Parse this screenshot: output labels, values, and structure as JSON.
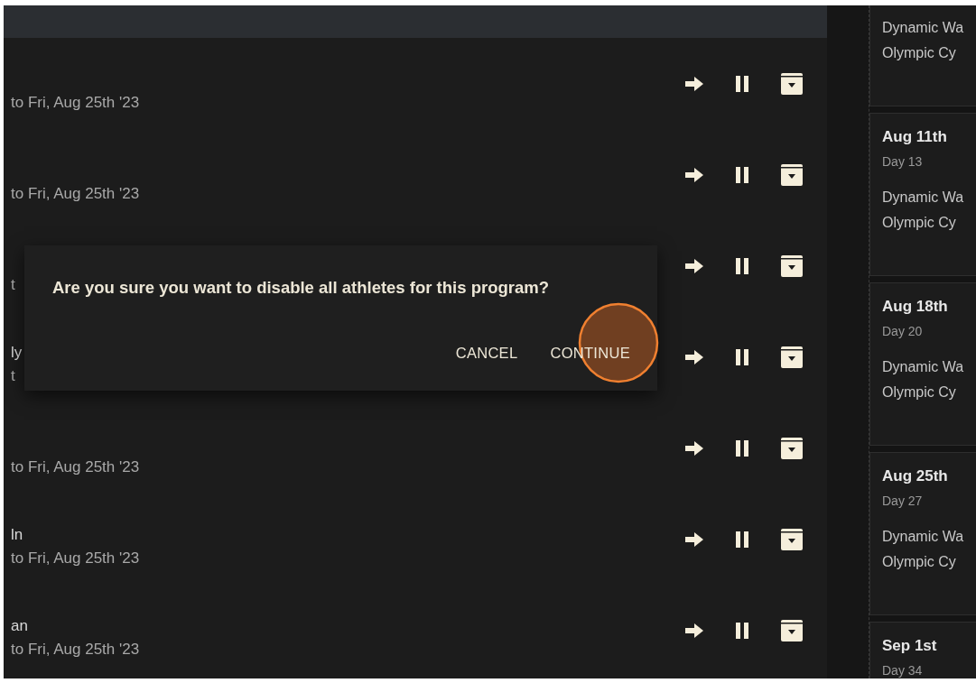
{
  "rows": [
    {
      "date": "to Fri, Aug 25th '23"
    },
    {
      "date": "to Fri, Aug 25th '23"
    },
    {
      "date": "t"
    },
    {
      "name": "ly",
      "date": "t"
    },
    {
      "date": "to Fri, Aug 25th '23"
    },
    {
      "name": "ln",
      "date": "to Fri, Aug 25th '23"
    },
    {
      "name": "an",
      "date": "to Fri, Aug 25th '23"
    }
  ],
  "schedule": [
    {
      "workouts": [
        "Dynamic Wa",
        "Olympic Cy"
      ]
    },
    {
      "date": "Aug 11th",
      "day": "Day 13",
      "workouts": [
        "Dynamic Wa",
        "Olympic Cy"
      ]
    },
    {
      "date": "Aug 18th",
      "day": "Day 20",
      "workouts": [
        "Dynamic Wa",
        "Olympic Cy"
      ]
    },
    {
      "date": "Aug 25th",
      "day": "Day 27",
      "workouts": [
        "Dynamic Wa",
        "Olympic Cy"
      ]
    },
    {
      "date": "Sep 1st",
      "day": "Day 34"
    }
  ],
  "dialog": {
    "message": "Are you sure you want to disable all athletes for this program?",
    "buttons": [
      "CANCEL",
      "CONTINUE"
    ]
  }
}
